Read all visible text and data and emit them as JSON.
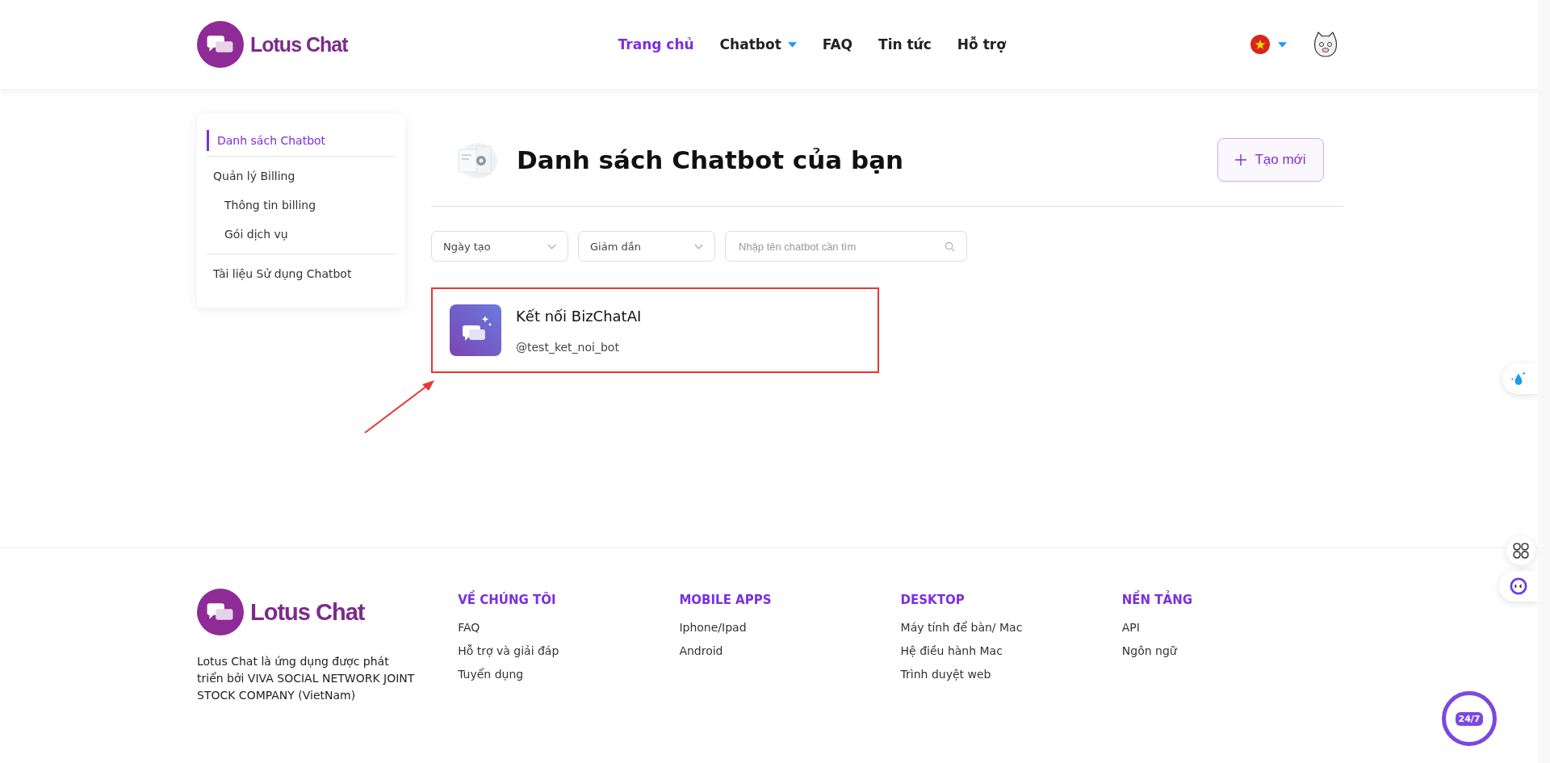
{
  "header": {
    "logo_text": "Lotus Chat",
    "nav": [
      {
        "label": "Trang chủ",
        "selected": true,
        "dropdown": false
      },
      {
        "label": "Chatbot",
        "selected": false,
        "dropdown": true
      },
      {
        "label": "FAQ",
        "selected": false,
        "dropdown": false
      },
      {
        "label": "Tin tức",
        "selected": false,
        "dropdown": false
      },
      {
        "label": "Hỗ trợ",
        "selected": false,
        "dropdown": false
      }
    ]
  },
  "sidebar": {
    "items": [
      {
        "label": "Danh sách Chatbot",
        "selected": true
      },
      {
        "label": "Quản lý Billing",
        "selected": false,
        "children": [
          {
            "label": "Thông tin billing",
            "selected": false
          },
          {
            "label": "Gói dịch vụ",
            "selected": false
          }
        ]
      },
      {
        "label": "Tài liệu Sử dụng Chatbot",
        "selected": false
      }
    ]
  },
  "main": {
    "title": "Danh sách Chatbot của bạn",
    "create_button": "Tạo mới",
    "filters": [
      {
        "kind": "select",
        "value": "Ngày tạo"
      },
      {
        "kind": "select",
        "value": "Giảm dần"
      },
      {
        "kind": "search",
        "placeholder": "Nhập tên chatbot cần tìm"
      }
    ],
    "bots": [
      {
        "name": "Kết nối BizChatAI",
        "handle": "@test_ket_noi_bot",
        "highlighted": true
      }
    ]
  },
  "footer": {
    "logo_text": "Lotus Chat",
    "about": "Lotus Chat là ứng dụng được phát triển bởi VIVA SOCIAL NETWORK JOINT STOCK COMPANY (VietNam)",
    "columns": [
      {
        "heading": "VỀ CHÚNG TÔI",
        "links": [
          "FAQ",
          "Hỗ trợ và giải đáp",
          "Tuyển dụng"
        ]
      },
      {
        "heading": "MOBILE APPS",
        "links": [
          "Iphone/Ipad",
          "Android"
        ]
      },
      {
        "heading": "DESKTOP",
        "links": [
          "Máy tính để bàn/ Mac",
          "Hệ điều hành Mac",
          "Trình duyệt web"
        ]
      },
      {
        "heading": "NỀN TẢNG",
        "links": [
          "API",
          "Ngôn ngữ"
        ]
      }
    ]
  },
  "support_badge": "24/7"
}
